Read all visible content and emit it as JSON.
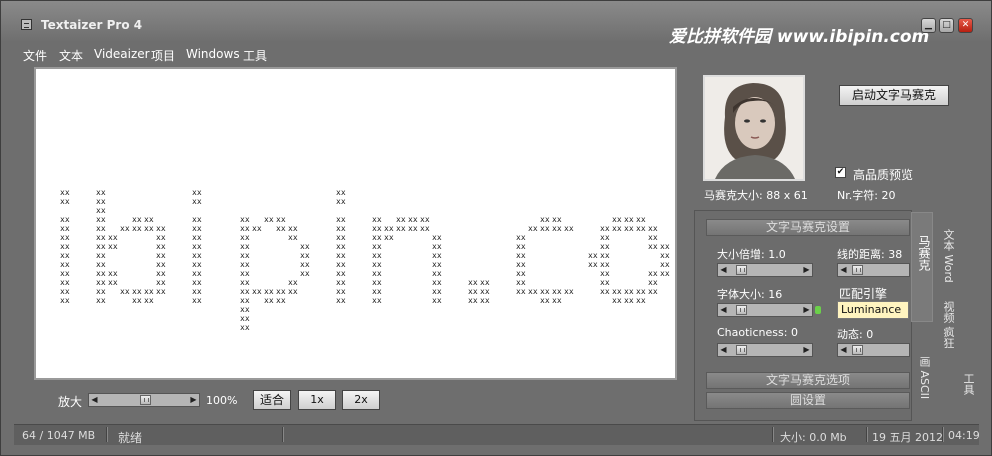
{
  "window": {
    "title": "Textaizer Pro 4",
    "watermark": "爱比拼软件园 www.ibipin.com"
  },
  "menu": [
    "文件",
    "文本",
    "Videaizer",
    "项目",
    "Windows",
    "工具"
  ],
  "canvas": {
    "char": "xx",
    "text": "ibipin.com"
  },
  "zoom": {
    "label": "放大",
    "value_text": "100%",
    "value": 100,
    "fit_label": "适合",
    "x1_label": "1x",
    "x2_label": "2x"
  },
  "right": {
    "start_button": "启动文字马赛克",
    "mosaic_size": "马赛克大小: 88 x 61",
    "hq_preview_label": "高品质预览",
    "hq_preview_checked": true,
    "chars_count": "Nr.字符: 20"
  },
  "settings": {
    "header": "文字马赛克设置",
    "size_multiplier": "大小倍增: 1.0",
    "line_distance": "线的距离: 38",
    "font_size": "字体大小: 16",
    "match_engine_label": "匹配引擎",
    "match_engine_value": "Luminance",
    "chaoticness": "Chaoticness: 0",
    "dynamic": "动态: 0",
    "options_button": "文字马赛克选项",
    "circle_settings_button": "圆设置"
  },
  "side_tabs": {
    "mosaic": "马赛克",
    "text_word": "文本 Word",
    "video_crazy": "视频 疯狂",
    "ascii_draw": "画 ASCII",
    "tools": "工具"
  },
  "status": {
    "memory": "64 / 1047 MB",
    "state": "就绪",
    "size": "大小: 0.0 Mb",
    "date": "19 五月 2012",
    "time": "04:19"
  },
  "colors": {
    "accent_combo": "#fff4c0",
    "close_button": "#d0301e"
  }
}
